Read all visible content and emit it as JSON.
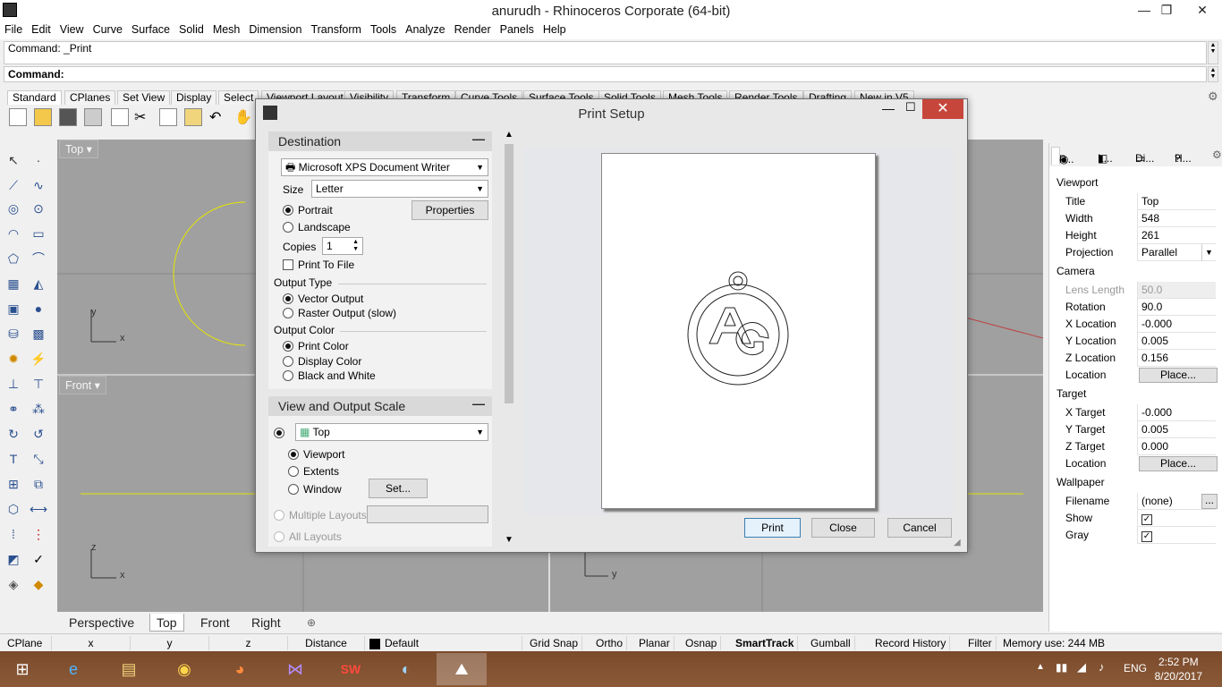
{
  "window": {
    "title": "anurudh - Rhinoceros Corporate (64-bit)",
    "min": "—",
    "max": "❐",
    "close": "✕"
  },
  "menu": [
    "File",
    "Edit",
    "View",
    "Curve",
    "Surface",
    "Solid",
    "Mesh",
    "Dimension",
    "Transform",
    "Tools",
    "Analyze",
    "Render",
    "Panels",
    "Help"
  ],
  "command": {
    "history": "Command: _Print",
    "prompt": "Command:"
  },
  "toolbar_tabs": [
    "Standard",
    "CPlanes",
    "Set View",
    "Display",
    "Select",
    "Viewport Layout",
    "Visibility",
    "Transform",
    "Curve Tools",
    "Surface Tools",
    "Solid Tools",
    "Mesh Tools",
    "Render Tools",
    "Drafting",
    "New in V5"
  ],
  "viewports": {
    "top_label": "Top",
    "front_label": "Front",
    "axis_y": "y",
    "axis_x": "x",
    "axis_z": "z"
  },
  "bottom_tabs": [
    "Perspective",
    "Top",
    "Front",
    "Right"
  ],
  "bottom_tabs_active": "Top",
  "add_tab": "⊕",
  "status": {
    "cplane": "CPlane",
    "x": "x",
    "y": "y",
    "z": "z",
    "distance": "Distance",
    "layer": "Default",
    "grid_snap": "Grid Snap",
    "ortho": "Ortho",
    "planar": "Planar",
    "osnap": "Osnap",
    "smarttrack": "SmartTrack",
    "gumball": "Gumball",
    "record_history": "Record History",
    "filter": "Filter",
    "memory": "Memory use: 244 MB"
  },
  "panel": {
    "tabs": [
      "P...",
      "L...",
      "Di...",
      "H..."
    ],
    "viewport_section": "Viewport",
    "title_k": "Title",
    "title_v": "Top",
    "width_k": "Width",
    "width_v": "548",
    "height_k": "Height",
    "height_v": "261",
    "projection_k": "Projection",
    "projection_v": "Parallel",
    "camera_section": "Camera",
    "lens_k": "Lens Length",
    "lens_v": "50.0",
    "rotation_k": "Rotation",
    "rotation_v": "90.0",
    "xloc_k": "X Location",
    "xloc_v": "-0.000",
    "yloc_k": "Y Location",
    "yloc_v": "0.005",
    "zloc_k": "Z Location",
    "zloc_v": "0.156",
    "location_k": "Location",
    "place_label": "Place...",
    "target_section": "Target",
    "xt_k": "X Target",
    "xt_v": "-0.000",
    "yt_k": "Y Target",
    "yt_v": "0.005",
    "zt_k": "Z Target",
    "zt_v": "0.000",
    "wallpaper_section": "Wallpaper",
    "filename_k": "Filename",
    "filename_v": "(none)",
    "filename_btn": "...",
    "show_k": "Show",
    "gray_k": "Gray",
    "check": "✓"
  },
  "dialog": {
    "title": "Print Setup",
    "destination": "Destination",
    "collapse": "—",
    "printer": "Microsoft XPS Document Writer",
    "size_label": "Size",
    "size_value": "Letter",
    "portrait": "Portrait",
    "landscape": "Landscape",
    "properties": "Properties",
    "copies_label": "Copies",
    "copies_value": "1",
    "print_to_file": "Print To File",
    "output_type": "Output Type",
    "vector_output": "Vector Output",
    "raster_output": "Raster Output (slow)",
    "output_color": "Output Color",
    "print_color": "Print Color",
    "display_color": "Display Color",
    "black_white": "Black and White",
    "view_scale": "View and Output Scale",
    "view_value": "Top",
    "viewport_opt": "Viewport",
    "extents_opt": "Extents",
    "window_opt": "Window",
    "set_btn": "Set...",
    "multiple_layouts": "Multiple Layouts",
    "all_layouts": "All Layouts",
    "print_btn": "Print",
    "close_btn": "Close",
    "cancel_btn": "Cancel"
  },
  "taskbar": {
    "time": "2:52 PM",
    "date": "8/20/2017",
    "lang": "ENG"
  }
}
